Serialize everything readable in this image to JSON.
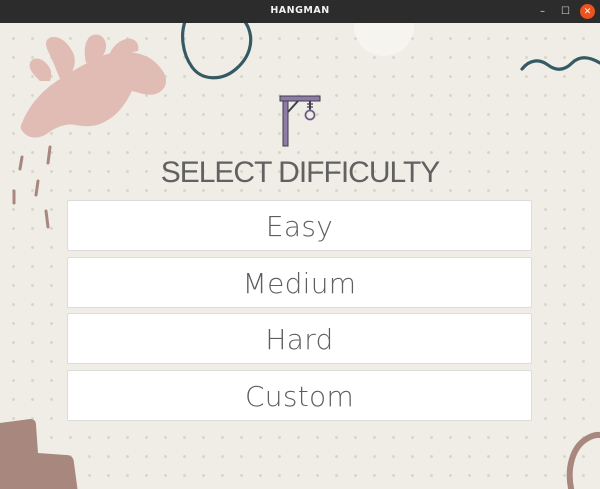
{
  "window": {
    "title": "HANGMAN",
    "controls": {
      "minimize": "–",
      "maximize": "☐",
      "close": "✕"
    }
  },
  "main": {
    "logo_icon": "gallows-icon",
    "heading": "SELECT DIFFICULTY",
    "options": [
      {
        "label": "Easy"
      },
      {
        "label": "Medium"
      },
      {
        "label": "Hard"
      },
      {
        "label": "Custom"
      }
    ]
  },
  "colors": {
    "background": "#efede5",
    "heading": "#616161",
    "button_bg": "#ffffff",
    "close_button": "#e95420",
    "leaf": "#e0bcb5",
    "squiggle": "#355a64",
    "brown_shape": "#a8877f"
  }
}
